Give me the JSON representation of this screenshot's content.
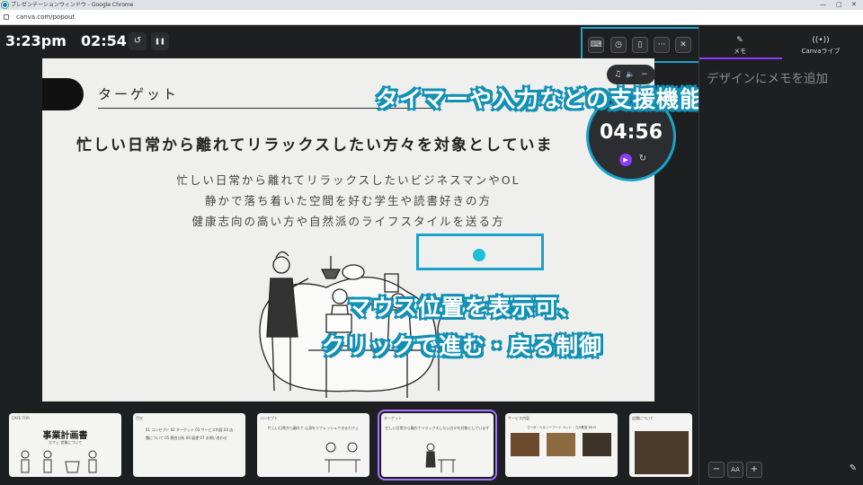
{
  "window": {
    "title": "プレゼンテーションウィンドウ - Google Chrome",
    "url": "canva.com/popout",
    "controls": [
      "—",
      "▢",
      "✕"
    ]
  },
  "presenter": {
    "clock": "3:23pm",
    "elapsed": "02:54",
    "reset_icon": "↺",
    "pause_icon": "❚❚",
    "toolbar": {
      "keyboard_icon": "⌨",
      "timer_icon": "◷",
      "remote_icon": "▯",
      "more_icon": "···",
      "close_icon": "✕"
    }
  },
  "slide": {
    "title": "ターゲット",
    "headline": "忙しい日常から離れてリラックスしたい方々を対象としていま",
    "lines": [
      "忙しい日常から離れてリラックスしたいビジネスマンやOL",
      "静かで落ち着いた空間を好む学生や読書好きの方",
      "健康志向の高い方や自然派のライフスタイルを送る方"
    ]
  },
  "mini_controls": {
    "music_icon": "♫",
    "volume_icon": "🔈",
    "minimize_icon": "−"
  },
  "timer_widget": {
    "value": "04:56",
    "play_icon": "▶",
    "reset_icon": "↻"
  },
  "captions": {
    "top": "タイマーや入力などの支援機能あり",
    "middle_line1": "マウス位置を表示可、",
    "middle_line2": "クリックで進む・戻る制御"
  },
  "right_panel": {
    "tabs": [
      {
        "label": "メモ",
        "icon": "✎"
      },
      {
        "label": "Canvaライブ",
        "icon": "((•))"
      }
    ],
    "memo_placeholder": "デザインにメモを追加",
    "zoom_out": "−",
    "font_size": "AA",
    "zoom_in": "+",
    "edit_icon": "✎"
  },
  "filmstrip": {
    "thumbs": [
      {
        "label": "CAFE FOR",
        "title": "事業計画書",
        "subtitle": "カフェ 営業について"
      },
      {
        "label": "目次",
        "title": "",
        "subtitle": "01 コンセプト  02 ターゲット  03 サービス内容  04 店舗について  05 競合分析  06 展望  07 お問い合わせ"
      },
      {
        "label": "コンセプト",
        "title": "",
        "subtitle": "忙しい日常から離れて 心身をリフレッシュできるカフェ"
      },
      {
        "label": "ターゲット",
        "title": "",
        "subtitle": "忙しい日常から離れてリラックスしたい方々を対象としています"
      },
      {
        "label": "サービス内容",
        "title": "",
        "subtitle": "ヨーガ・ヘルシーフード  ペット・ヨガ教室  Wi-Fi"
      },
      {
        "label": "店舗について",
        "title": "",
        "subtitle": ""
      }
    ]
  }
}
